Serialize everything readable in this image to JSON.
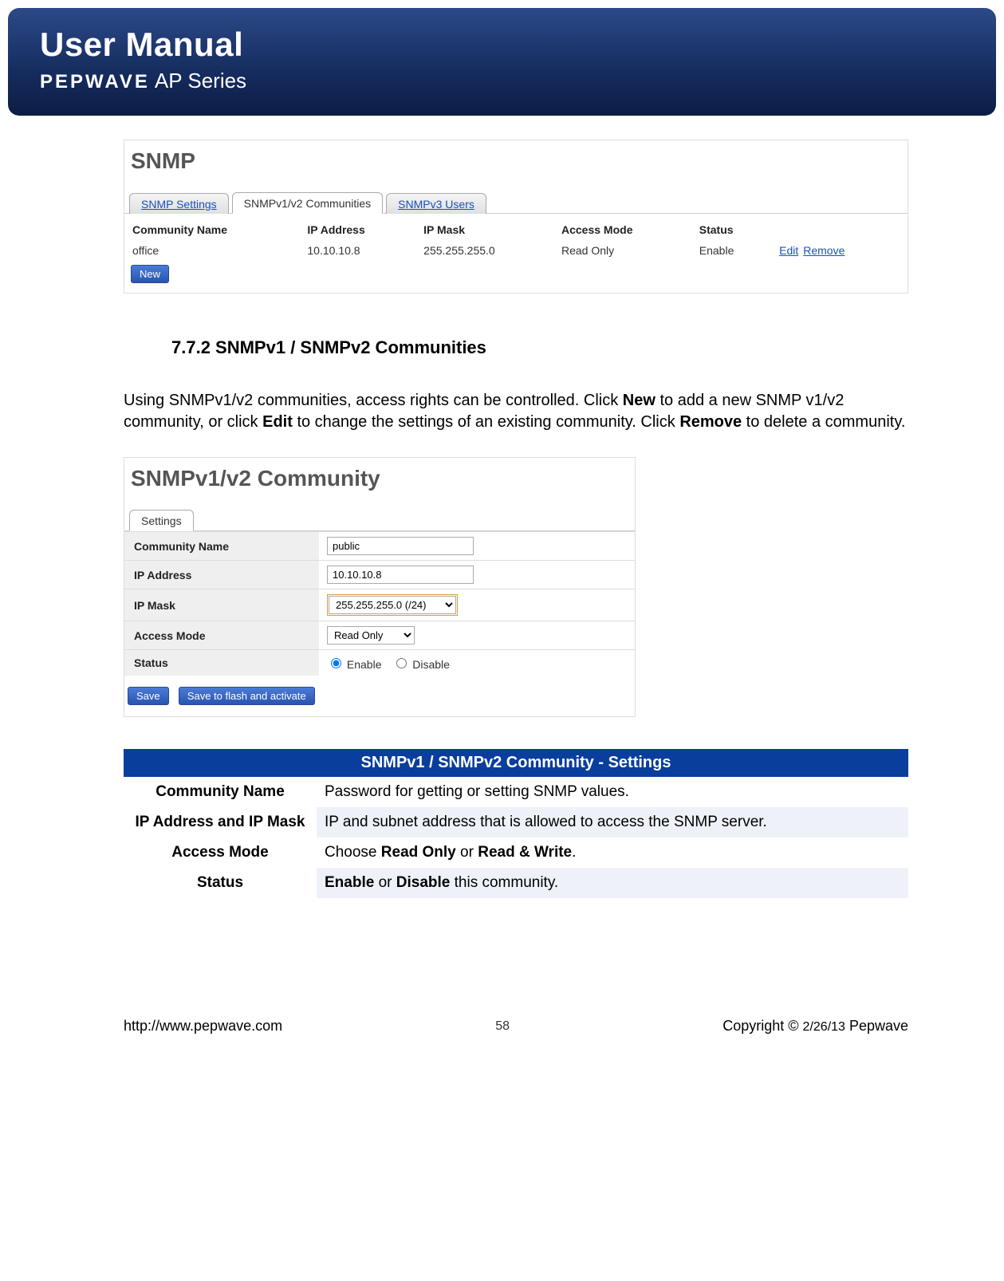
{
  "header": {
    "title": "User Manual",
    "brand": "PEPWAVE",
    "series": "AP Series"
  },
  "screenshot1": {
    "title": "SNMP",
    "tabs": [
      "SNMP Settings",
      "SNMPv1/v2 Communities",
      "SNMPv3 Users"
    ],
    "active_tab_index": 1,
    "columns": [
      "Community Name",
      "IP Address",
      "IP Mask",
      "Access Mode",
      "Status",
      ""
    ],
    "row": {
      "name": "office",
      "ip": "10.10.10.8",
      "mask": "255.255.255.0",
      "mode": "Read Only",
      "status": "Enable"
    },
    "actions": {
      "edit": "Edit",
      "remove": "Remove"
    },
    "new_btn": "New"
  },
  "section": {
    "heading": "7.7.2 SNMPv1 / SNMPv2 Communities",
    "para_1": "Using SNMPv1/v2 communities, access rights can be controlled. Click ",
    "para_new": "New",
    "para_2": " to add a new SNMP v1/v2 community, or click ",
    "para_edit": "Edit",
    "para_3": " to change the settings of an existing community. Click ",
    "para_remove": "Remove",
    "para_4": " to delete a community."
  },
  "screenshot2": {
    "title": "SNMPv1/v2 Community",
    "tab": "Settings",
    "rows": {
      "community_name_label": "Community Name",
      "community_name_value": "public",
      "ip_label": "IP Address",
      "ip_value": "10.10.10.8",
      "mask_label": "IP Mask",
      "mask_value": "255.255.255.0 (/24)",
      "mode_label": "Access Mode",
      "mode_value": "Read Only",
      "status_label": "Status",
      "status_enable": "Enable",
      "status_disable": "Disable"
    },
    "buttons": {
      "save": "Save",
      "save_flash": "Save to flash and activate"
    }
  },
  "settings_table": {
    "header": "SNMPv1 / SNMPv2 Community - Settings",
    "rows": [
      {
        "label": "Community Name",
        "desc_pre": "Password for getting or setting SNMP values.",
        "bold1": "",
        "mid": "",
        "bold2": "",
        "post": ""
      },
      {
        "label": "IP Address and IP Mask",
        "desc_pre": "IP and subnet address that is allowed to access the SNMP server.",
        "bold1": "",
        "mid": "",
        "bold2": "",
        "post": ""
      },
      {
        "label": "Access Mode",
        "desc_pre": "Choose ",
        "bold1": "Read Only",
        "mid": " or ",
        "bold2": "Read & Write",
        "post": "."
      },
      {
        "label": "Status",
        "desc_pre": "",
        "bold1": "Enable",
        "mid": " or ",
        "bold2": "Disable",
        "post": " this community."
      }
    ]
  },
  "footer": {
    "url": "http://www.pepwave.com",
    "page": "58",
    "copyright_pre": "Copyright © ",
    "copyright_date": "2/26/13",
    "copyright_post": " Pepwave"
  }
}
